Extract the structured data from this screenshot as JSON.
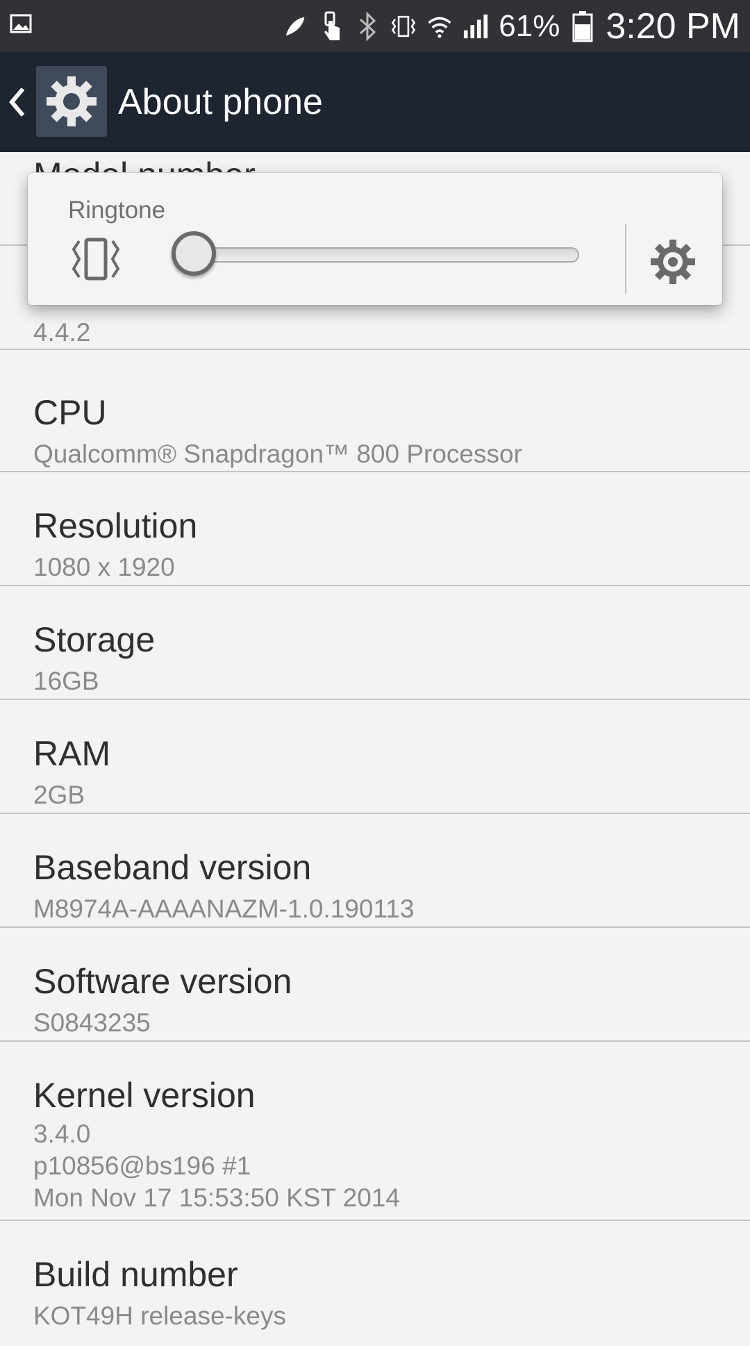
{
  "status_bar": {
    "battery_percent": "61%",
    "time": "3:20 PM",
    "icons": [
      "gallery-icon",
      "rocket-icon",
      "touch-icon",
      "bluetooth-icon",
      "vibrate-icon",
      "wifi-icon",
      "signal-icon",
      "battery-icon"
    ]
  },
  "action_bar": {
    "title": "About phone"
  },
  "volume_popup": {
    "label": "Ringtone",
    "level": 0
  },
  "rows": [
    {
      "title": "Model number",
      "subtitle": ""
    },
    {
      "title": "",
      "subtitle": "4.4.2"
    },
    {
      "title": "CPU",
      "subtitle": "Qualcomm® Snapdragon™ 800 Processor"
    },
    {
      "title": "Resolution",
      "subtitle": "1080 x 1920"
    },
    {
      "title": "Storage",
      "subtitle": "16GB"
    },
    {
      "title": "RAM",
      "subtitle": "2GB"
    },
    {
      "title": "Baseband version",
      "subtitle": "M8974A-AAAANAZM-1.0.190113"
    },
    {
      "title": "Software version",
      "subtitle": "S0843235"
    },
    {
      "title": "Kernel version",
      "subtitle": "3.4.0\np10856@bs196 #1\nMon Nov 17 15:53:50 KST 2014"
    },
    {
      "title": "Build number",
      "subtitle": "KOT49H release-keys"
    }
  ]
}
